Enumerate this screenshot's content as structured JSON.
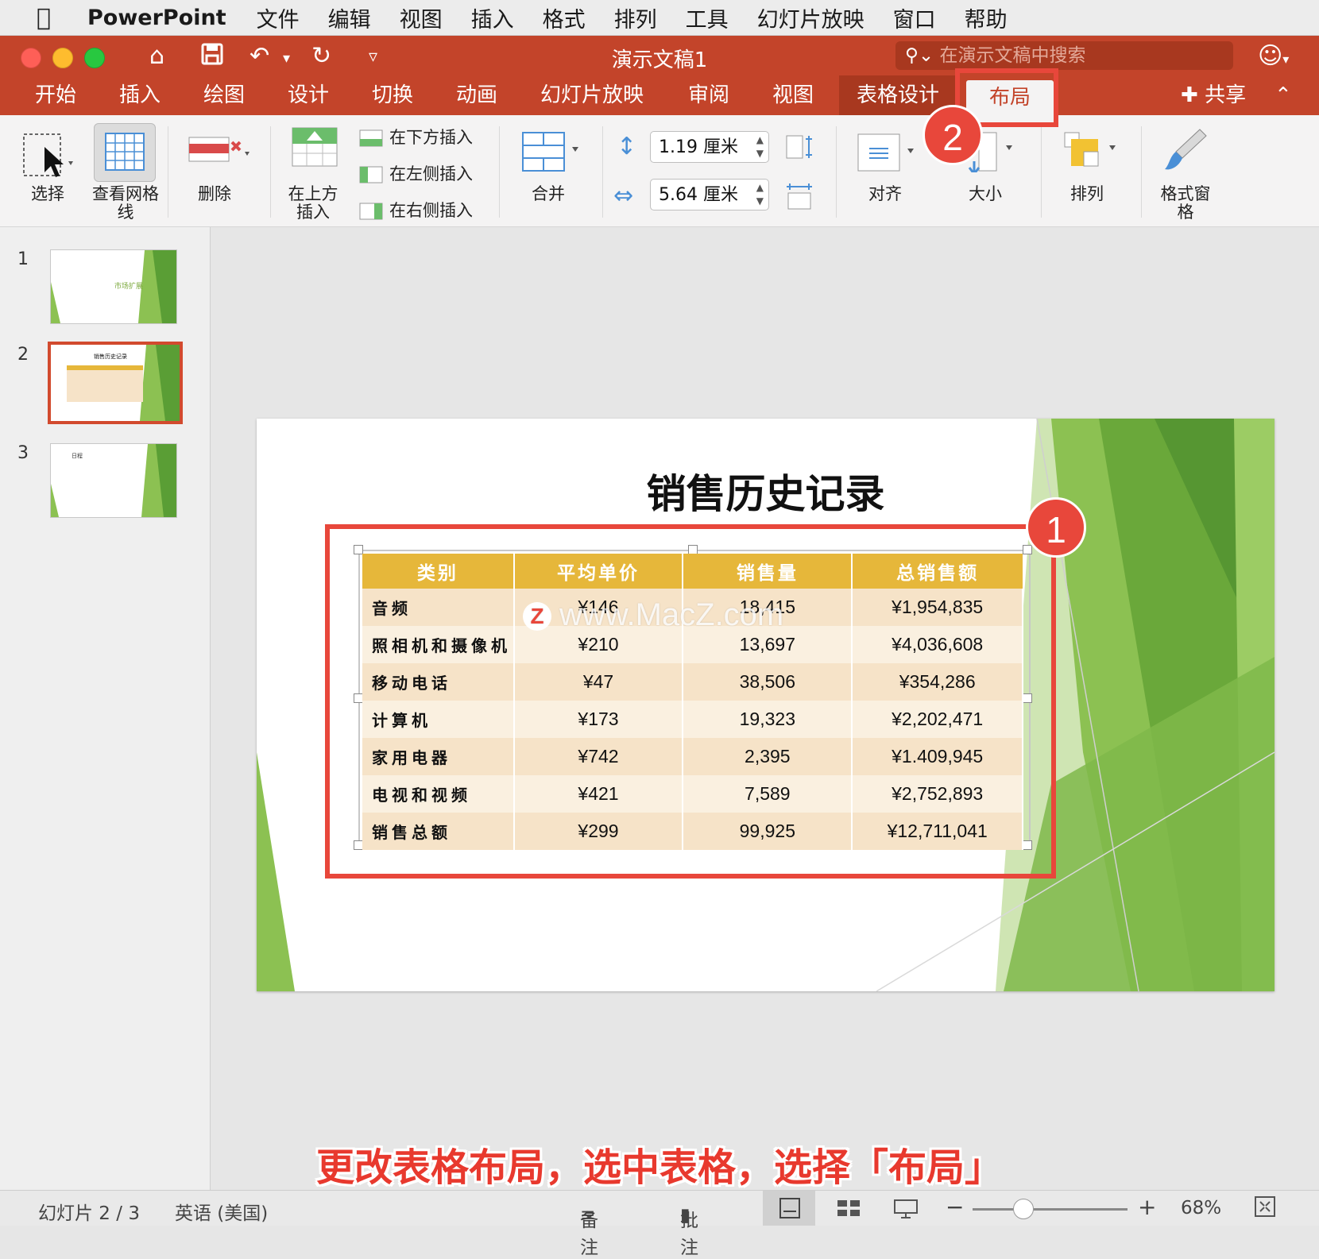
{
  "menubar": {
    "app": "PowerPoint",
    "items": [
      "文件",
      "编辑",
      "视图",
      "插入",
      "格式",
      "排列",
      "工具",
      "幻灯片放映",
      "窗口",
      "帮助"
    ]
  },
  "window": {
    "title": "演示文稿1",
    "search_placeholder": "在演示文稿中搜索"
  },
  "tabs": [
    "开始",
    "插入",
    "绘图",
    "设计",
    "切换",
    "动画",
    "幻灯片放映",
    "审阅",
    "视图",
    "表格设计",
    "布局"
  ],
  "active_tab": "布局",
  "share_label": "共享",
  "ribbon": {
    "select": "选择",
    "view_gridlines": "查看网格线",
    "delete": "删除",
    "insert_above": "在上方插入",
    "insert_below": "在下方插入",
    "insert_left": "在左侧插入",
    "insert_right": "在右侧插入",
    "merge": "合并",
    "height_value": "1.19 厘米",
    "width_value": "5.64 厘米",
    "align": "对齐",
    "size": "大小",
    "arrange": "排列",
    "format_pane": "格式窗格"
  },
  "thumbnails": [
    {
      "num": "1",
      "title": "市场扩展"
    },
    {
      "num": "2",
      "title": "销售历史记录"
    },
    {
      "num": "3",
      "title": "日程"
    }
  ],
  "slide": {
    "title": "销售历史记录",
    "table": {
      "headers": [
        "类别",
        "平均单价",
        "销售量",
        "总销售额"
      ],
      "rows": [
        [
          "音频",
          "¥146",
          "18,415",
          "¥1,954,835"
        ],
        [
          "照相机和摄像机",
          "¥210",
          "13,697",
          "¥4,036,608"
        ],
        [
          "移动电话",
          "¥47",
          "38,506",
          "¥354,286"
        ],
        [
          "计算机",
          "¥173",
          "19,323",
          "¥2,202,471"
        ],
        [
          "家用电器",
          "¥742",
          "2,395",
          "¥1.409,945"
        ],
        [
          "电视和视频",
          "¥421",
          "7,589",
          "¥2,752,893"
        ],
        [
          "销售总额",
          "¥299",
          "99,925",
          "¥12,711,041"
        ]
      ]
    }
  },
  "annotations": {
    "badge1": "1",
    "badge2": "2",
    "watermark": "www.MacZ.com",
    "watermark_logo": "Z",
    "caption": "更改表格布局，选中表格，选择「布局」"
  },
  "status": {
    "slide_counter": "幻灯片 2 / 3",
    "language": "英语 (美国)",
    "notes": "备注",
    "comments": "批注",
    "zoom": "68%"
  },
  "colors": {
    "titlebar": "#c3442a",
    "highlight": "#e8473b",
    "table_header": "#e6b73a",
    "green": "#6aa83a"
  }
}
